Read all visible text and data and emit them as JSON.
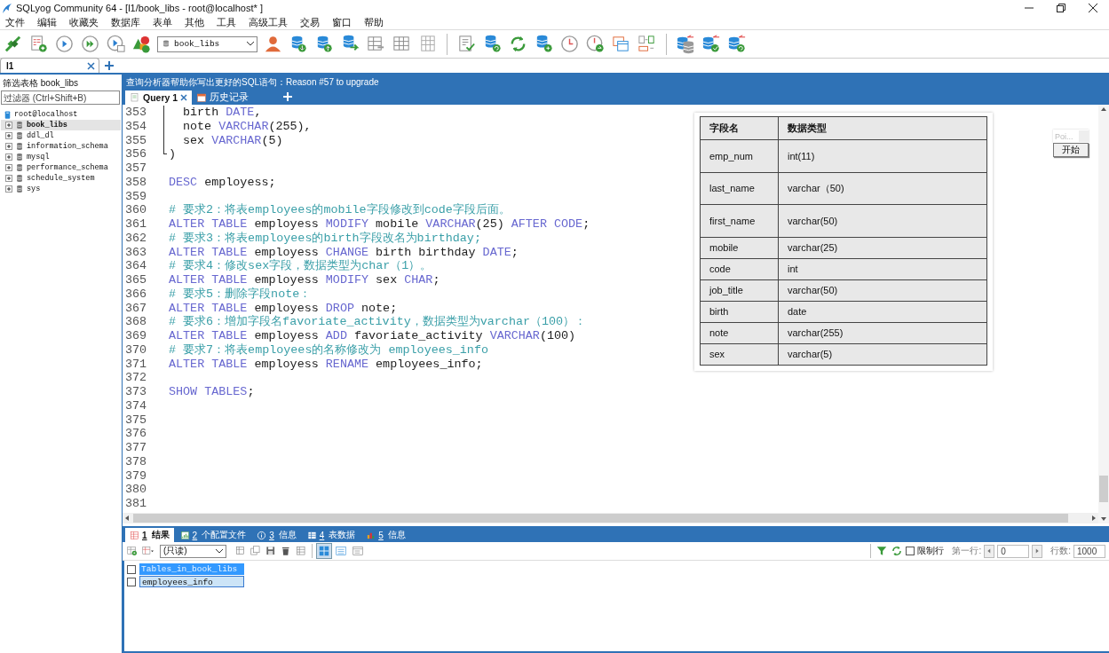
{
  "window": {
    "title": "SQLyog Community 64 - [l1/book_libs - root@localhost* ]"
  },
  "menu": [
    "文件",
    "编辑",
    "收藏夹",
    "数据库",
    "表单",
    "其他",
    "工具",
    "高级工具",
    "交易",
    "窗口",
    "帮助"
  ],
  "toolbar": {
    "database": "book_libs"
  },
  "connection_tabs": [
    {
      "label": "l1",
      "selected": true
    }
  ],
  "sidebar": {
    "title": "筛选表格 book_libs",
    "filter": {
      "placeholder": "过滤器 (Ctrl+Shift+B)"
    },
    "root": {
      "label": "root@localhost",
      "children": [
        {
          "label": "book_libs",
          "selected": true,
          "expanded": false
        },
        {
          "label": "ddl_dl",
          "selected": false,
          "expanded": false
        },
        {
          "label": "information_schema",
          "selected": false,
          "expanded": false
        },
        {
          "label": "mysql",
          "selected": false,
          "expanded": false
        },
        {
          "label": "performance_schema",
          "selected": false,
          "expanded": false
        },
        {
          "label": "schedule_system",
          "selected": false,
          "expanded": false
        },
        {
          "label": "sys",
          "selected": false,
          "expanded": false
        }
      ]
    }
  },
  "hint_bar": "查询分析器帮助你写出更好的SQL语句：Reason #57 to upgrade",
  "editor_tabs": [
    {
      "label": "Query 1",
      "selected": true,
      "kind": "query"
    },
    {
      "label": "历史记录",
      "selected": false,
      "kind": "history"
    }
  ],
  "editor": {
    "lines": [
      {
        "number": "353",
        "kind": "block",
        "segments": [
          {
            "kind": "text",
            "text": "birth "
          },
          {
            "kind": "kw",
            "text": "DATE"
          },
          {
            "kind": "text",
            "text": ","
          }
        ]
      },
      {
        "number": "354",
        "kind": "block",
        "segments": [
          {
            "kind": "text",
            "text": "note "
          },
          {
            "kind": "kw",
            "text": "VARCHAR"
          },
          {
            "kind": "text",
            "text": "(255),"
          }
        ]
      },
      {
        "number": "355",
        "kind": "block",
        "segments": [
          {
            "kind": "text",
            "text": "sex "
          },
          {
            "kind": "kw",
            "text": "VARCHAR"
          },
          {
            "kind": "text",
            "text": "(5)"
          }
        ]
      },
      {
        "number": "356",
        "kind": "block_end",
        "segments": [
          {
            "kind": "text",
            "text": ")"
          }
        ]
      },
      {
        "number": "357"
      },
      {
        "number": "358",
        "segments": [
          {
            "kind": "kw",
            "text": "DESC"
          },
          {
            "kind": "text",
            "text": " employess;"
          }
        ]
      },
      {
        "number": "359"
      },
      {
        "number": "360",
        "segments": [
          {
            "kind": "comment",
            "text": "# 要求2：将表employees的mobile字段修改到code字段后面。"
          }
        ]
      },
      {
        "number": "361",
        "segments": [
          {
            "kind": "kw",
            "text": "ALTER TABLE"
          },
          {
            "kind": "text",
            "text": " employess "
          },
          {
            "kind": "kw",
            "text": "MODIFY"
          },
          {
            "kind": "text",
            "text": " mobile "
          },
          {
            "kind": "kw",
            "text": "VARCHAR"
          },
          {
            "kind": "text",
            "text": "(25) "
          },
          {
            "kind": "kw",
            "text": "AFTER CODE"
          },
          {
            "kind": "text",
            "text": ";"
          }
        ]
      },
      {
        "number": "362",
        "segments": [
          {
            "kind": "comment",
            "text": "# 要求3：将表employees的birth字段改名为birthday;"
          }
        ]
      },
      {
        "number": "363",
        "segments": [
          {
            "kind": "kw",
            "text": "ALTER TABLE"
          },
          {
            "kind": "text",
            "text": " employess "
          },
          {
            "kind": "kw",
            "text": "CHANGE"
          },
          {
            "kind": "text",
            "text": " birth birthday "
          },
          {
            "kind": "kw",
            "text": "DATE"
          },
          {
            "kind": "text",
            "text": ";"
          }
        ]
      },
      {
        "number": "364",
        "segments": [
          {
            "kind": "comment",
            "text": "# 要求4：修改sex字段，数据类型为char（1）。"
          }
        ]
      },
      {
        "number": "365",
        "segments": [
          {
            "kind": "kw",
            "text": "ALTER TABLE"
          },
          {
            "kind": "text",
            "text": " employess "
          },
          {
            "kind": "kw",
            "text": "MODIFY"
          },
          {
            "kind": "text",
            "text": " sex "
          },
          {
            "kind": "kw",
            "text": "CHAR"
          },
          {
            "kind": "text",
            "text": ";"
          }
        ]
      },
      {
        "number": "366",
        "segments": [
          {
            "kind": "comment",
            "text": "# 要求5：删除字段note："
          }
        ]
      },
      {
        "number": "367",
        "segments": [
          {
            "kind": "kw",
            "text": "ALTER TABLE"
          },
          {
            "kind": "text",
            "text": " employess "
          },
          {
            "kind": "kw",
            "text": "DROP"
          },
          {
            "kind": "text",
            "text": " note;"
          }
        ]
      },
      {
        "number": "368",
        "segments": [
          {
            "kind": "comment",
            "text": "# 要求6：增加字段名favoriate_activity，数据类型为varchar（100）："
          }
        ]
      },
      {
        "number": "369",
        "segments": [
          {
            "kind": "kw",
            "text": "ALTER TABLE"
          },
          {
            "kind": "text",
            "text": " employess "
          },
          {
            "kind": "kw",
            "text": "ADD"
          },
          {
            "kind": "text",
            "text": " favoriate_activity "
          },
          {
            "kind": "kw",
            "text": "VARCHAR"
          },
          {
            "kind": "text",
            "text": "(100)"
          }
        ]
      },
      {
        "number": "370",
        "segments": [
          {
            "kind": "comment",
            "text": "# 要求7：将表employees的名称修改为 employees_info"
          }
        ]
      },
      {
        "number": "371",
        "segments": [
          {
            "kind": "kw",
            "text": "ALTER TABLE"
          },
          {
            "kind": "text",
            "text": " employess "
          },
          {
            "kind": "kw",
            "text": "RENAME"
          },
          {
            "kind": "text",
            "text": " employees_info;"
          }
        ]
      },
      {
        "number": "372"
      },
      {
        "number": "373",
        "segments": [
          {
            "kind": "kw",
            "text": "SHOW TABLES"
          },
          {
            "kind": "text",
            "text": ";"
          }
        ]
      },
      {
        "number": "374"
      },
      {
        "number": "375"
      },
      {
        "number": "376"
      },
      {
        "number": "377"
      },
      {
        "number": "378"
      },
      {
        "number": "379"
      },
      {
        "number": "380"
      },
      {
        "number": "381"
      }
    ]
  },
  "image_table": {
    "columns": [
      "字段名",
      "数据类型"
    ],
    "rows": [
      [
        "emp_num",
        "int(11)"
      ],
      [
        "last_name",
        "varchar（50)"
      ],
      [
        "first_name",
        "varchar(50)"
      ],
      [
        "mobile",
        "varchar(25)"
      ],
      [
        "code",
        "int"
      ],
      [
        "job_title",
        "varchar(50)"
      ],
      [
        "birth",
        "date"
      ],
      [
        "note",
        "varchar(255)"
      ],
      [
        "sex",
        "varchar(5)"
      ]
    ]
  },
  "mini_widget": {
    "field": "Poi...",
    "button": "开始"
  },
  "result_tabs": [
    {
      "number": "1",
      "label": "结果",
      "selected": true,
      "kind": "result"
    },
    {
      "number": "2",
      "label": "个配置文件",
      "selected": false,
      "kind": "profile"
    },
    {
      "number": "3",
      "label": "信息",
      "selected": false,
      "kind": "info"
    },
    {
      "number": "4",
      "label": "表数据",
      "selected": false,
      "kind": "table"
    },
    {
      "number": "5",
      "label": "信息",
      "selected": false,
      "kind": "stats"
    }
  ],
  "result_toolbar": {
    "mode": "(只读)",
    "limit_rows": {
      "label": "限制行",
      "checked": false
    },
    "first_row": {
      "label": "第一行:",
      "value": "0"
    },
    "row_count": {
      "label": "行数:",
      "value": "1000"
    }
  },
  "results": {
    "column": "Tables_in_book_libs",
    "header_checked": false,
    "rows": [
      {
        "value": "employees_info",
        "selected": true,
        "checked": false
      }
    ]
  }
}
